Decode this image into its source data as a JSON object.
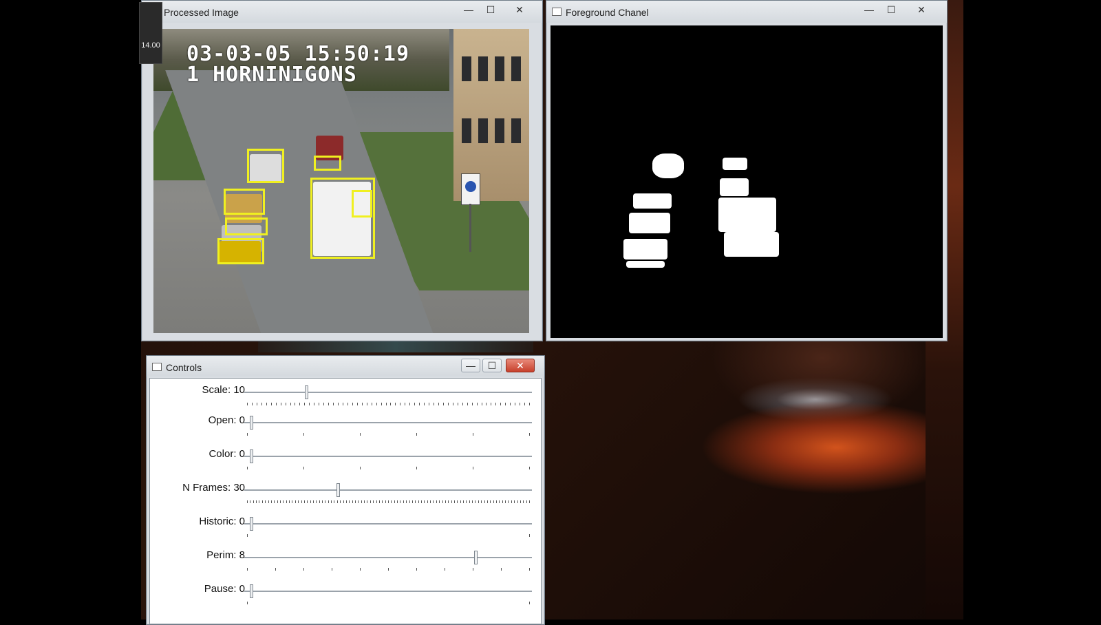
{
  "overlay": {
    "fps_value": "14.00"
  },
  "processed_window": {
    "title": "Processed Image",
    "timestamp_line1": "03-03-05 15:50:19",
    "timestamp_line2": "1 HORNINIGONS",
    "buttons": {
      "minimize": "—",
      "maximize": "☐",
      "close": "✕"
    }
  },
  "foreground_window": {
    "title": "Foreground Chanel",
    "buttons": {
      "minimize": "—",
      "maximize": "☐",
      "close": "✕"
    }
  },
  "controls_window": {
    "title": "Controls",
    "buttons": {
      "minimize": "—",
      "maximize": "☐",
      "close": "✕"
    },
    "sliders": [
      {
        "label": "Scale: 10",
        "value": 10,
        "position": 0.21,
        "ticks": 60
      },
      {
        "label": "Open: 0",
        "value": 0,
        "position": 0.02,
        "ticks": 6
      },
      {
        "label": "Color: 0",
        "value": 0,
        "position": 0.02,
        "ticks": 6
      },
      {
        "label": "N Frames: 30",
        "value": 30,
        "position": 0.32,
        "ticks": 95
      },
      {
        "label": "Historic: 0",
        "value": 0,
        "position": 0.02,
        "ticks": 2
      },
      {
        "label": "Perim: 8",
        "value": 8,
        "position": 0.8,
        "ticks": 11
      },
      {
        "label": "Pause: 0",
        "value": 0,
        "position": 0.02,
        "ticks": 2
      }
    ]
  },
  "colors": {
    "bbox": "#f0f020",
    "close_button": "#c7402b"
  }
}
